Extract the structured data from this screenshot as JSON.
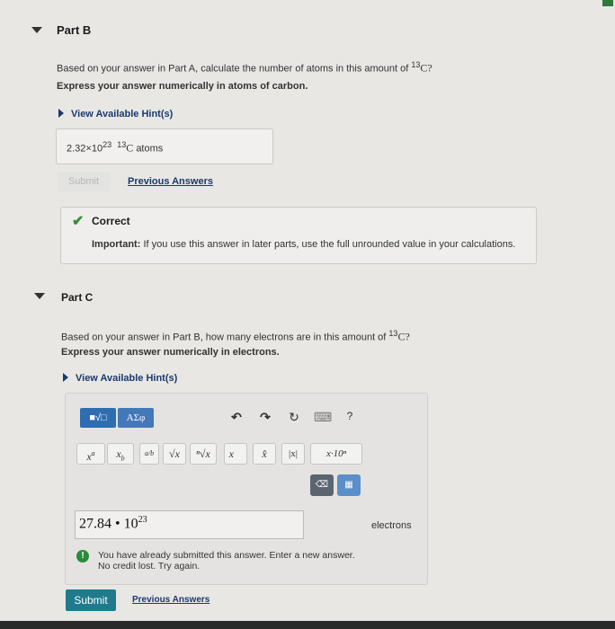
{
  "partB": {
    "title": "Part B",
    "question_prefix": "Based on your answer in Part A, calculate the number of atoms in this amount of",
    "question_sup": "13",
    "question_suffix": "C?",
    "instruction": "Express your answer numerically in atoms of carbon.",
    "hint_label": "View Available Hint(s)",
    "answer_mantissa": "2.32×10",
    "answer_exp": "23",
    "answer_sup": "13",
    "answer_c": "C",
    "answer_unit": "atoms",
    "submit_label": "Submit",
    "previous_answers_label": "Previous Answers",
    "feedback_title": "Correct",
    "feedback_important_label": "Important:",
    "feedback_text": "If you use this answer in later parts, use the full unrounded value in your calculations."
  },
  "partC": {
    "title": "Part C",
    "question_prefix": "Based on your answer in Part B, how many electrons are in this amount of",
    "question_sup": "13",
    "question_suffix": "C?",
    "instruction": "Express your answer numerically in electrons.",
    "hint_label": "View Available Hint(s)",
    "toolbar": {
      "templates_label": "■√□",
      "greek_label": "ΑΣφ",
      "undo": "↶",
      "redo": "↷",
      "reset": "↻",
      "keyboard": "⌨",
      "help": "?",
      "superscript": "x",
      "superscript_a": "a",
      "subscript": "x",
      "subscript_b": "b",
      "fraction": "a/b",
      "sqrt": "√x",
      "nthroot": "ⁿ√x",
      "vector": "x⃗",
      "hat": "x̂",
      "abs": "|x|",
      "sci": "x·10ⁿ",
      "delete": "⌫",
      "keypad": "▦"
    },
    "answer_value": "27.84 • 10",
    "answer_exp": "23",
    "answer_unit": "electrons",
    "warning_text_1": "You have already submitted this answer. Enter a new answer.",
    "warning_text_2": "No credit lost. Try again.",
    "submit_label": "Submit",
    "previous_answers_label": "Previous Answers"
  }
}
